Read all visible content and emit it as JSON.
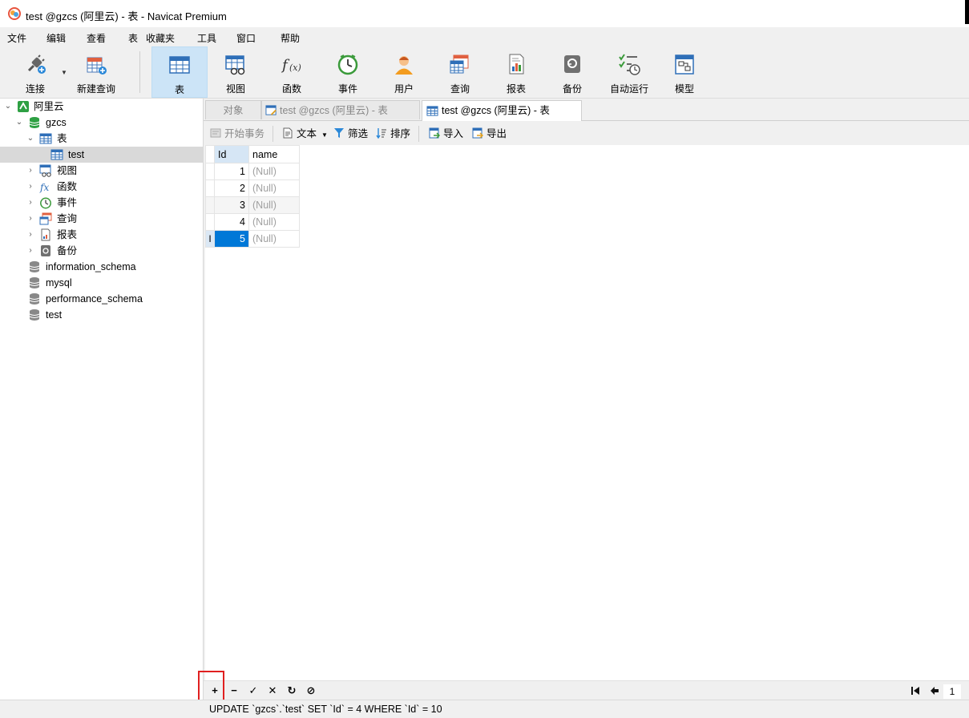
{
  "window": {
    "title": "test @gzcs (阿里云) - 表 - Navicat Premium"
  },
  "menu": [
    "文件",
    "编辑",
    "查看",
    "表",
    "收藏夹",
    "工具",
    "窗口",
    "帮助"
  ],
  "toolbar": {
    "connect": "连接",
    "new_query": "新建查询",
    "table": "表",
    "view": "视图",
    "function": "函数",
    "event": "事件",
    "user": "用户",
    "query": "查询",
    "report": "报表",
    "backup": "备份",
    "automation": "自动运行",
    "model": "模型"
  },
  "sidebar": {
    "connection": "阿里云",
    "database": "gzcs",
    "tables_label": "表",
    "table_item": "test",
    "views": "视图",
    "functions": "函数",
    "events": "事件",
    "queries": "查询",
    "reports": "报表",
    "backups": "备份",
    "other_dbs": [
      "information_schema",
      "mysql",
      "performance_schema",
      "test"
    ]
  },
  "tabs": {
    "objects": "对象",
    "tab1": "test @gzcs (阿里云) - 表",
    "tab2": "test @gzcs (阿里云) - 表"
  },
  "subtoolbar": {
    "begin_transaction": "开始事务",
    "text": "文本",
    "filter": "筛选",
    "sort": "排序",
    "import": "导入",
    "export": "导出"
  },
  "grid": {
    "columns": [
      "Id",
      "name"
    ],
    "rows": [
      [
        "1",
        "(Null)"
      ],
      [
        "2",
        "(Null)"
      ],
      [
        "3",
        "(Null)"
      ],
      [
        "4",
        "(Null)"
      ],
      [
        "5",
        "(Null)"
      ]
    ],
    "cursor_marker": "I"
  },
  "bottombar": {
    "add": "+",
    "delete": "−",
    "apply": "✓",
    "cancel": "✕",
    "refresh": "↻",
    "stop": "⊘",
    "page": "1"
  },
  "status": {
    "sql": "UPDATE `gzcs`.`test` SET `Id` = 4 WHERE `Id` = 10"
  },
  "colors": {
    "selection": "#0078d7",
    "active_tool": "#cce4f7",
    "highlight_box": "#e02020"
  }
}
